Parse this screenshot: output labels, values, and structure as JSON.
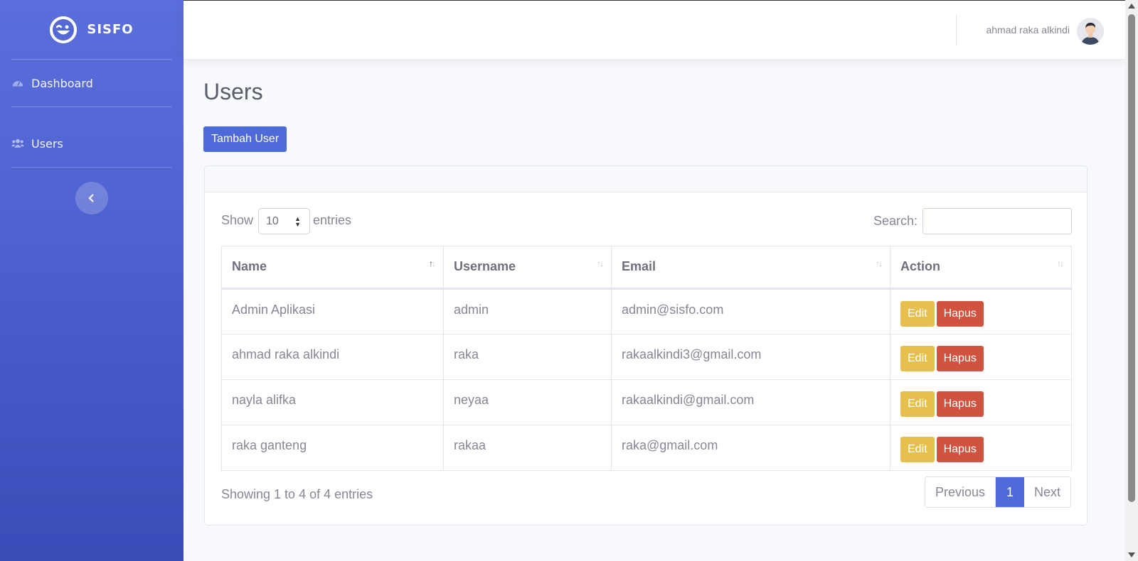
{
  "brand": {
    "name": "SISFO",
    "logo_icon": "laugh-wink-icon"
  },
  "sidebar": {
    "items": [
      {
        "label": "Dashboard",
        "icon": "tachometer-icon"
      },
      {
        "label": "Users",
        "icon": "users-icon"
      }
    ],
    "toggle_icon": "chevron-left-icon"
  },
  "topbar": {
    "user_name": "ahmad raka alkindi"
  },
  "page": {
    "title": "Users",
    "add_button": "Tambah User"
  },
  "datatable": {
    "show_label": "Show",
    "length_value": "10",
    "entries_label": "entries",
    "search_label": "Search:",
    "search_value": "",
    "columns": [
      "Name",
      "Username",
      "Email",
      "Action"
    ],
    "rows": [
      {
        "name": "Admin Aplikasi",
        "username": "admin",
        "email": "admin@sisfo.com"
      },
      {
        "name": "ahmad raka alkindi",
        "username": "raka",
        "email": "rakaalkindi3@gmail.com"
      },
      {
        "name": "nayla alifka",
        "username": "neyaa",
        "email": "rakaalkindi@gmail.com"
      },
      {
        "name": "raka ganteng",
        "username": "rakaa",
        "email": "raka@gmail.com"
      }
    ],
    "edit_label": "Edit",
    "delete_label": "Hapus",
    "info": "Showing 1 to 4 of 4 entries",
    "pager": {
      "previous": "Previous",
      "current": "1",
      "next": "Next"
    }
  },
  "colors": {
    "primary": "#4e6ad9",
    "warning": "#e7bf4e",
    "danger": "#d1523f",
    "sidebar_gradient_top": "#5a6fdc",
    "sidebar_gradient_bottom": "#3b4bb8"
  }
}
